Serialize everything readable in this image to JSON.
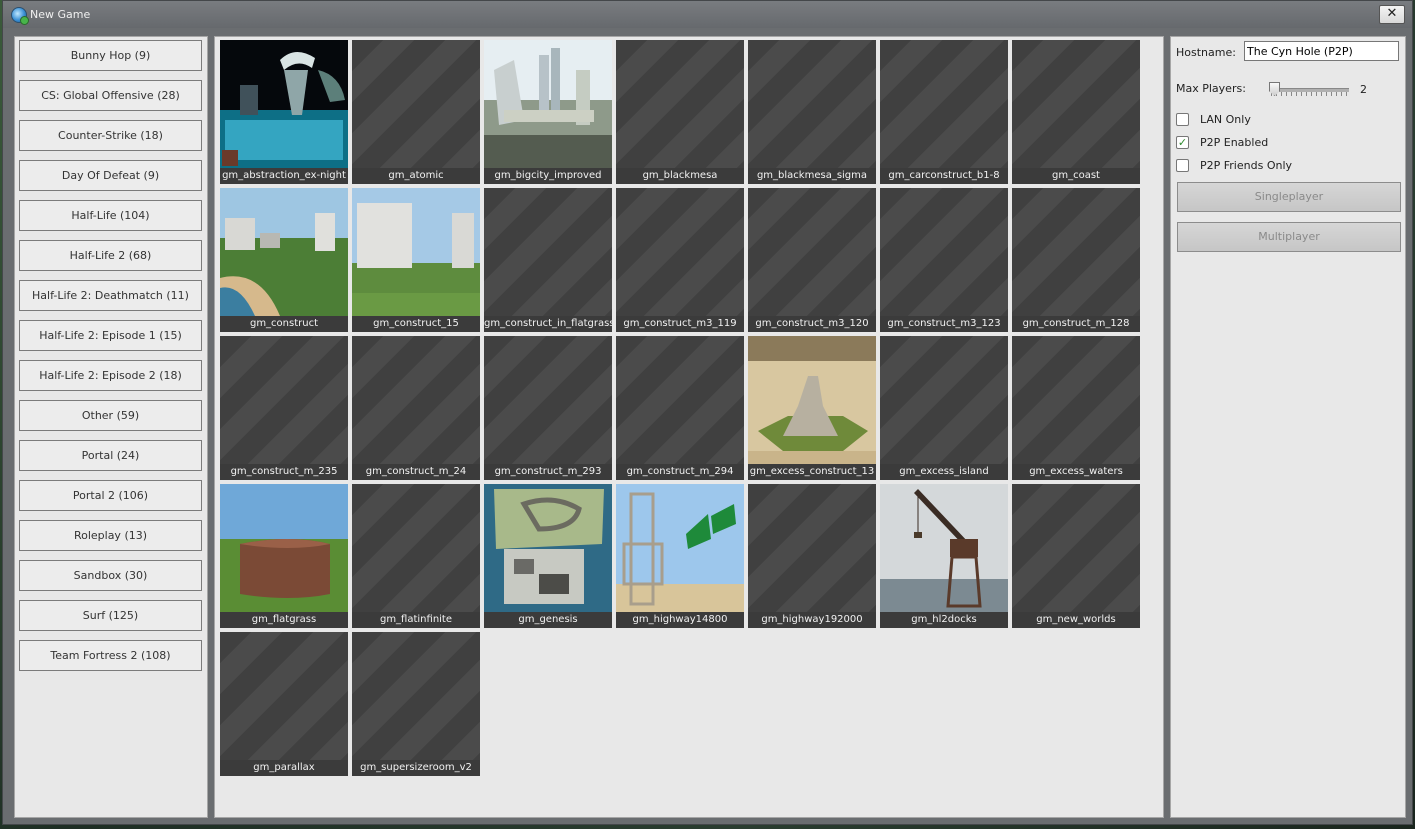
{
  "window": {
    "title": "New Game",
    "close_label": "✕"
  },
  "categories": [
    "Bunny Hop (9)",
    "CS: Global Offensive (28)",
    "Counter-Strike (18)",
    "Day Of Defeat (9)",
    "Half-Life (104)",
    "Half-Life 2 (68)",
    "Half-Life 2: Deathmatch (11)",
    "Half-Life 2: Episode 1 (15)",
    "Half-Life 2: Episode 2 (18)",
    "Other (59)",
    "Portal (24)",
    "Portal 2 (106)",
    "Roleplay (13)",
    "Sandbox (30)",
    "Surf (125)",
    "Team Fortress 2 (108)"
  ],
  "maps": [
    {
      "name": "gm_abstraction_ex-night",
      "thumb": "night-pool"
    },
    {
      "name": "gm_atomic",
      "thumb": "none"
    },
    {
      "name": "gm_bigcity_improved",
      "thumb": "city"
    },
    {
      "name": "gm_blackmesa",
      "thumb": "none"
    },
    {
      "name": "gm_blackmesa_sigma",
      "thumb": "none"
    },
    {
      "name": "gm_carconstruct_b1-8",
      "thumb": "none"
    },
    {
      "name": "gm_coast",
      "thumb": "none"
    },
    {
      "name": "gm_construct",
      "thumb": "construct"
    },
    {
      "name": "gm_construct_15",
      "thumb": "construct2"
    },
    {
      "name": "gm_construct_in_flatgrass",
      "thumb": "none"
    },
    {
      "name": "gm_construct_m3_119",
      "thumb": "none"
    },
    {
      "name": "gm_construct_m3_120",
      "thumb": "none"
    },
    {
      "name": "gm_construct_m3_123",
      "thumb": "none"
    },
    {
      "name": "gm_construct_m_128",
      "thumb": "none"
    },
    {
      "name": "gm_construct_m_235",
      "thumb": "none"
    },
    {
      "name": "gm_construct_m_24",
      "thumb": "none"
    },
    {
      "name": "gm_construct_m_293",
      "thumb": "none"
    },
    {
      "name": "gm_construct_m_294",
      "thumb": "none"
    },
    {
      "name": "gm_excess_construct_13",
      "thumb": "excess"
    },
    {
      "name": "gm_excess_island",
      "thumb": "none"
    },
    {
      "name": "gm_excess_waters",
      "thumb": "none"
    },
    {
      "name": "gm_flatgrass",
      "thumb": "flatgrass"
    },
    {
      "name": "gm_flatinfinite",
      "thumb": "none"
    },
    {
      "name": "gm_genesis",
      "thumb": "genesis"
    },
    {
      "name": "gm_highway14800",
      "thumb": "highway"
    },
    {
      "name": "gm_highway192000",
      "thumb": "none"
    },
    {
      "name": "gm_hl2docks",
      "thumb": "docks"
    },
    {
      "name": "gm_new_worlds",
      "thumb": "none"
    },
    {
      "name": "gm_parallax",
      "thumb": "none"
    },
    {
      "name": "gm_supersizeroom_v2",
      "thumb": "none"
    }
  ],
  "settings": {
    "hostname_label": "Hostname:",
    "hostname_value": "The Cyn Hole (P2P)",
    "max_players_label": "Max Players:",
    "max_players_value": "2",
    "lan_only_label": "LAN Only",
    "lan_only_checked": false,
    "p2p_enabled_label": "P2P Enabled",
    "p2p_enabled_checked": true,
    "p2p_friends_label": "P2P Friends Only",
    "p2p_friends_checked": false,
    "singleplayer_label": "Singleplayer",
    "multiplayer_label": "Multiplayer"
  }
}
